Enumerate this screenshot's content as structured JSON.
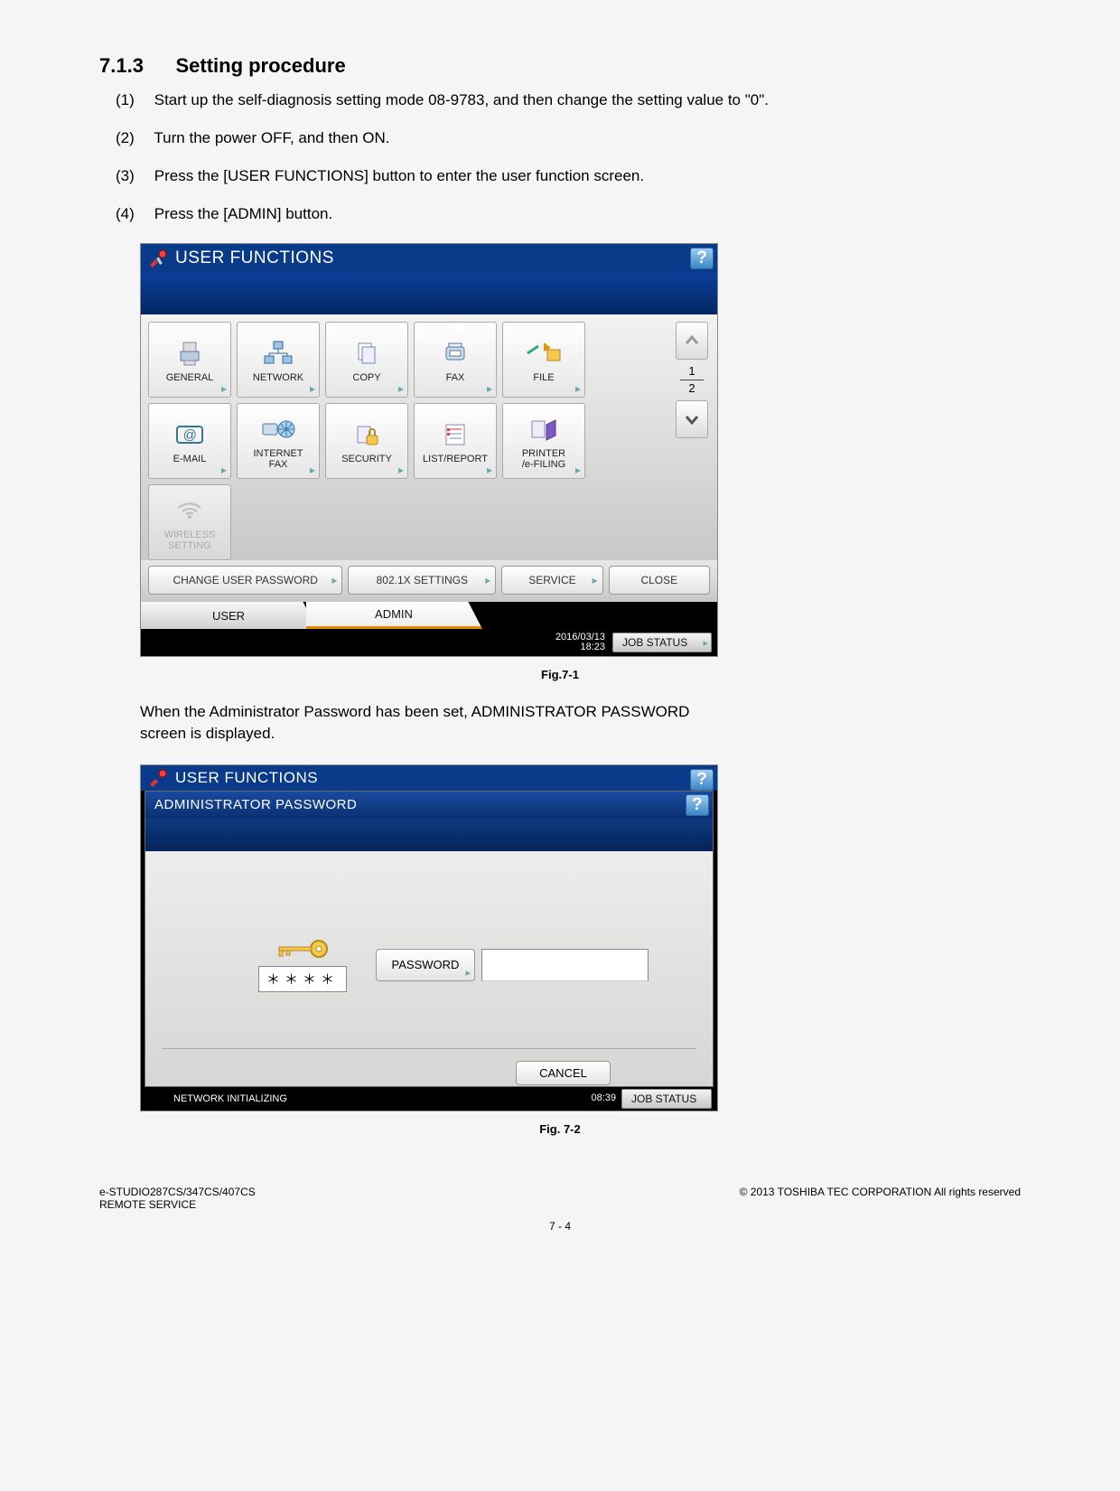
{
  "heading": {
    "number": "7.1.3",
    "title": "Setting procedure"
  },
  "steps": {
    "s1": {
      "num": "(1)",
      "txt": "Start up the self-diagnosis setting mode 08-9783, and then change the setting value to \"0\"."
    },
    "s2": {
      "num": "(2)",
      "txt": "Turn the power OFF, and then ON."
    },
    "s3": {
      "num": "(3)",
      "txt": "Press the [USER FUNCTIONS] button to enter the user function screen."
    },
    "s4": {
      "num": "(4)",
      "txt": "Press the [ADMIN] button."
    }
  },
  "fig1": {
    "title": "USER FUNCTIONS",
    "help": "?",
    "tiles": {
      "general": "GENERAL",
      "network": "NETWORK",
      "copy": "COPY",
      "fax": "FAX",
      "file": "FILE",
      "email": "E-MAIL",
      "ifax": "INTERNET\nFAX",
      "security": "SECURITY",
      "listreport": "LIST/REPORT",
      "printer": "PRINTER\n/e-FILING",
      "wireless": "WIRELESS\nSETTING"
    },
    "page_top": "1",
    "page_bot": "2",
    "midbtns": {
      "changepwd": "CHANGE USER PASSWORD",
      "x8021x": "802.1X SETTINGS",
      "service": "SERVICE",
      "close": "CLOSE"
    },
    "tabs": {
      "user": "USER",
      "admin": "ADMIN"
    },
    "footer": {
      "date": "2016/03/13",
      "time": "18:23",
      "jobstatus": "JOB STATUS"
    },
    "caption": "Fig.7-1"
  },
  "midtext": "When the Administrator Password has been set, ADMINISTRATOR PASSWORD screen is displayed.",
  "fig2": {
    "bg_title": "USER FUNCTIONS",
    "dlg_title": "ADMINISTRATOR PASSWORD",
    "help": "?",
    "stars": "＊＊＊＊",
    "pwd_btn": "PASSWORD",
    "cancel": "CANCEL",
    "footer": {
      "net": "NETWORK INITIALIZING",
      "time": "08:39",
      "jobstatus": "JOB STATUS"
    },
    "caption": "Fig. 7-2"
  },
  "page_footer": {
    "left1": "e-STUDIO287CS/347CS/407CS",
    "left2": "REMOTE SERVICE",
    "right": "© 2013 TOSHIBA TEC CORPORATION All rights reserved",
    "center": "7 - 4"
  }
}
